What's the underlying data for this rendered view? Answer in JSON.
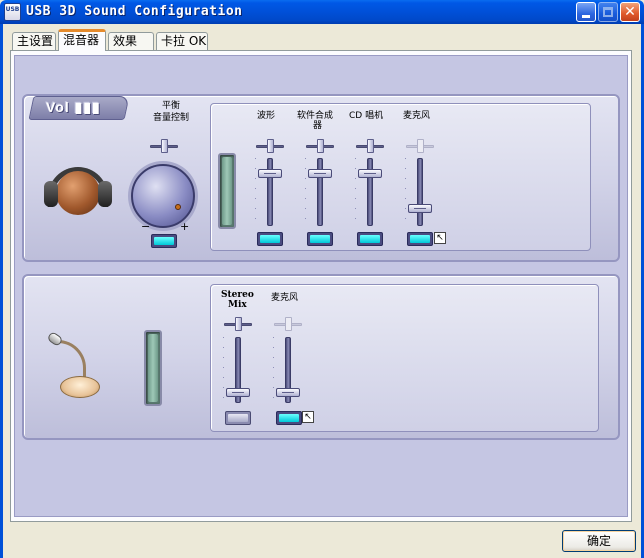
{
  "window": {
    "title": "USB 3D Sound Configuration",
    "icon_text": "USB",
    "controls": [
      "minimize-icon",
      "maximize-icon",
      "close-icon"
    ],
    "close_glyph": "✕"
  },
  "tabs": [
    {
      "label": "主设置",
      "selected": false
    },
    {
      "label": "混音器",
      "selected": true
    },
    {
      "label": "效果",
      "selected": false
    },
    {
      "label": "卡拉 OK",
      "selected": false
    }
  ],
  "playback": {
    "vol_label": "Vol",
    "balance_label_line1": "平衡",
    "balance_label_line2": "音量控制",
    "knob_minus": "−",
    "knob_plus": "+",
    "master_muted": false,
    "channels": [
      {
        "label": "波形",
        "level": 0.82,
        "muted": false,
        "enabled": true
      },
      {
        "label": "软件合成",
        "label_line2": "器",
        "level": 0.82,
        "muted": false,
        "enabled": true
      },
      {
        "label": "CD 唱机",
        "level": 0.82,
        "muted": false,
        "enabled": true
      },
      {
        "label": "麦克风",
        "level": 0.22,
        "muted": false,
        "enabled": true,
        "balance_disabled": true,
        "has_advanced": true
      }
    ]
  },
  "record": {
    "channels": [
      {
        "label": "Stereo",
        "label_line2": "Mix",
        "level": 0.1,
        "selected": false,
        "balance_enabled": true
      },
      {
        "label": "麦克风",
        "level": 0.1,
        "selected": true,
        "balance_enabled": false,
        "has_advanced": true
      }
    ]
  },
  "footer": {
    "ok_label": "确定"
  },
  "colors": {
    "titlebar": "#0050d8",
    "panel_bg": "#c5c6e3",
    "mute_on": "#00c8d8",
    "active_tab_accent": "#e68b2c"
  }
}
